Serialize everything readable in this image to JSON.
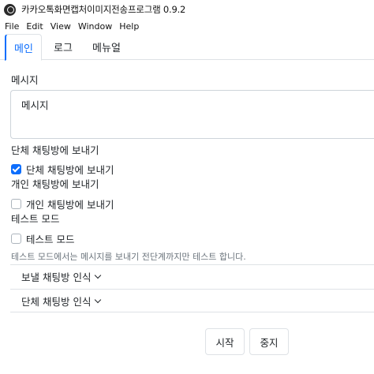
{
  "window": {
    "title": "카카오톡화면캡처이미지전송프로그램 0.9.2"
  },
  "menu": {
    "items": [
      "File",
      "Edit",
      "View",
      "Window",
      "Help"
    ]
  },
  "tabs": [
    {
      "label": "메인",
      "active": true
    },
    {
      "label": "로그",
      "active": false
    },
    {
      "label": "메뉴얼",
      "active": false
    }
  ],
  "message": {
    "label": "메시지",
    "value": "메시지"
  },
  "group_chat": {
    "section_label": "단체 채팅방에 보내기",
    "checkbox_label": "단체 채팅방에 보내기",
    "checked": true
  },
  "personal_chat": {
    "section_label": "개인 채팅방에 보내기",
    "checkbox_label": "개인 채팅방에 보내기",
    "checked": false
  },
  "test_mode": {
    "section_label": "테스트 모드",
    "checkbox_label": "테스트 모드",
    "checked": false,
    "hint": "테스트 모드에서는 메시지를 보내기 전단계까지만 테스트 합니다."
  },
  "accordions": [
    {
      "label": "보낼 채팅방 인식"
    },
    {
      "label": "단체 채팅방 인식"
    }
  ],
  "buttons": {
    "start": "시작",
    "stop": "중지"
  },
  "colors": {
    "accent": "#0d6efd",
    "border": "#dee2e6",
    "hint": "#6c757d"
  }
}
